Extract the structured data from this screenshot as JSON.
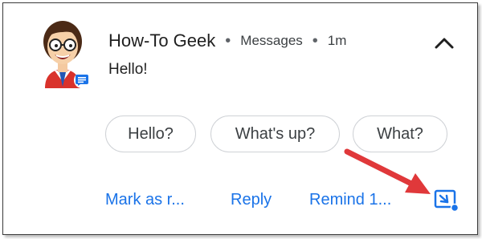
{
  "notification": {
    "sender": "How-To Geek",
    "app": "Messages",
    "time": "1m",
    "message": "Hello!",
    "replies": [
      "Hello?",
      "What's up?",
      "What?"
    ],
    "actions": [
      "Mark as r...",
      "Reply",
      "Remind 1..."
    ]
  },
  "icons": {
    "avatar": "cartoon-avatar",
    "app_badge": "messages-icon",
    "expand": "chevron-up-icon",
    "bubble": "bubble-icon",
    "annotation": "red-arrow"
  },
  "colors": {
    "action_blue": "#1a73e8",
    "arrow_red": "#e0383a",
    "chip_border": "#cfd2d6"
  }
}
